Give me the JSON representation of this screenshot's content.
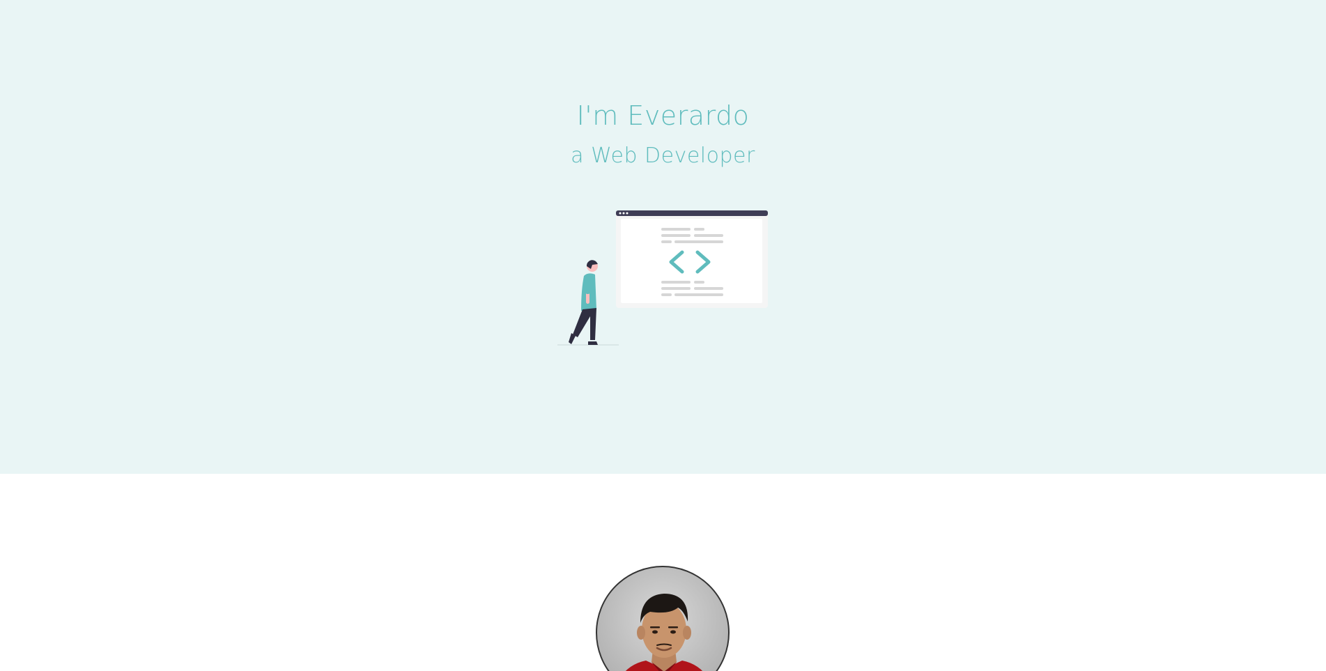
{
  "hero": {
    "title": "I'm Everardo",
    "subtitle": "a Web Developer",
    "background_color": "#e9f5f5",
    "accent_color": "#5fbcbd",
    "illustration_icon": "person-walking-to-code-window-illustration"
  },
  "about": {
    "avatar_icon": "profile-photo",
    "shirt_color": "#b0141a"
  }
}
